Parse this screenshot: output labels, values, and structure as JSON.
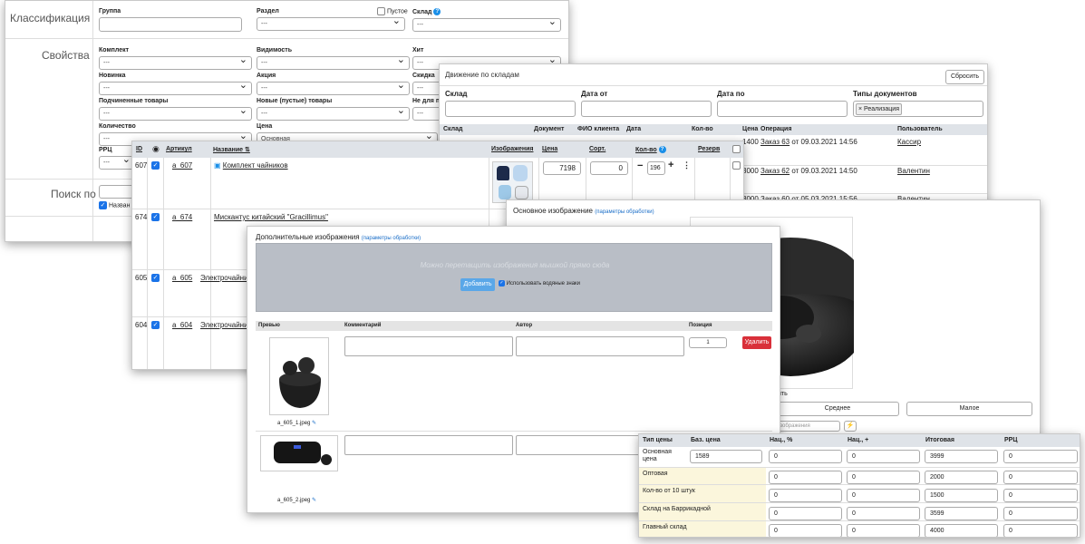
{
  "filters": {
    "classification_label": "Классификация",
    "properties_label": "Свойства",
    "search_label": "Поиск по",
    "group_label": "Группа",
    "section_label": "Раздел",
    "empty_label": "Пустое",
    "warehouse_label": "Склад",
    "set_label": "Комплект",
    "visibility_label": "Видимость",
    "hit_label": "Хит",
    "new_label": "Новинка",
    "promo_label": "Акция",
    "discount_label": "Скидка",
    "child_label": "Подчиненные товары",
    "new_empty_label": "Новые (пустые) товары",
    "not_for_label": "Не для п",
    "qty_label": "Количество",
    "price_label": "Цена",
    "price_value": "Основная",
    "rrp_label": "РРЦ",
    "dash": "---",
    "search_check_label": "Назван"
  },
  "movement": {
    "title": "Движение по складам",
    "reset": "Сбросить",
    "f_warehouse": "Склад",
    "f_date_from": "Дата от",
    "f_date_to": "Дата по",
    "f_doc_types": "Типы документов",
    "tag": "× Реализация",
    "cols": [
      "Склад",
      "Документ",
      "ФИО клиента",
      "Дата",
      "Кол-во",
      "Цена",
      "Операция",
      "Пользователь"
    ],
    "rows": [
      {
        "price": "1400",
        "op_link": "Заказ 63",
        "op_rest": " от 09.03.2021 14:56",
        "user": "Кассир"
      },
      {
        "price": "3000",
        "op_link": "Заказ 62",
        "op_rest": " от 09.03.2021 14:50",
        "user": "Валентин"
      },
      {
        "price": "3000",
        "op_link": "Заказ 60",
        "op_rest": " от 05.03.2021 15:56",
        "user": "Валентин"
      }
    ]
  },
  "products": {
    "cols": {
      "id": "ID",
      "article": "Артикул",
      "name": "Название ⇅",
      "images": "Изображения",
      "price": "Цена",
      "sort": "Сорт.",
      "qty": "Кол-во",
      "reserve": "Резерв"
    },
    "rows": [
      {
        "id": "607",
        "article": "a_607",
        "name": "Комплект чайников",
        "price": "7198",
        "sort": "0",
        "qty": "196"
      },
      {
        "id": "674",
        "article": "a_674",
        "name": "Мискантус китайский \"Gracillimus\""
      },
      {
        "id": "605",
        "article": "a_605",
        "name": "Электрочайник"
      },
      {
        "id": "604",
        "article": "a_604",
        "name": "Электрочайник"
      }
    ]
  },
  "main_image": {
    "title": "Основное изображение",
    "params": "(параметры обработки)",
    "size_medium": "Среднее",
    "size_small": "Малое",
    "frag_text": "ить",
    "alt_placeholder": "изображения"
  },
  "extra_images": {
    "title": "Дополнительные изображения",
    "params": "(параметры обработки)",
    "drop_text": "Можно перетащить изображения мышкой прямо сюда",
    "add_btn": "Добавить",
    "watermark_label": "Использовать водяные знаки",
    "cols": {
      "preview": "Превью",
      "comment": "Комментарий",
      "author": "Автор",
      "position": "Позиция"
    },
    "rows": [
      {
        "file": "a_605_1.jpeg",
        "position": "1",
        "delete": "Удалить"
      },
      {
        "file": "a_605_2.jpeg"
      }
    ]
  },
  "prices": {
    "cols": [
      "Тип цены",
      "Баз. цена",
      "Нац., %",
      "Нац., +",
      "Итоговая",
      "РРЦ"
    ],
    "rows": [
      {
        "type": "Основная цена",
        "base": "1589",
        "pct": "0",
        "plus": "0",
        "final": "3999",
        "rrp": "0"
      },
      {
        "type": "Оптовая",
        "base": "",
        "pct": "0",
        "plus": "0",
        "final": "2000",
        "rrp": "0"
      },
      {
        "type": "Кол-во от 10 штук",
        "base": "",
        "pct": "0",
        "plus": "0",
        "final": "1500",
        "rrp": "0"
      },
      {
        "type": "Склад на Баррикадной",
        "base": "",
        "pct": "0",
        "plus": "0",
        "final": "3599",
        "rrp": "0"
      },
      {
        "type": "Главный склад",
        "base": "",
        "pct": "0",
        "plus": "0",
        "final": "4000",
        "rrp": "0"
      }
    ]
  },
  "colors": {
    "accent": "#1a73e8",
    "danger": "#d9303a",
    "header": "#dfe3e8",
    "price_highlight": "#fbf6dc"
  }
}
